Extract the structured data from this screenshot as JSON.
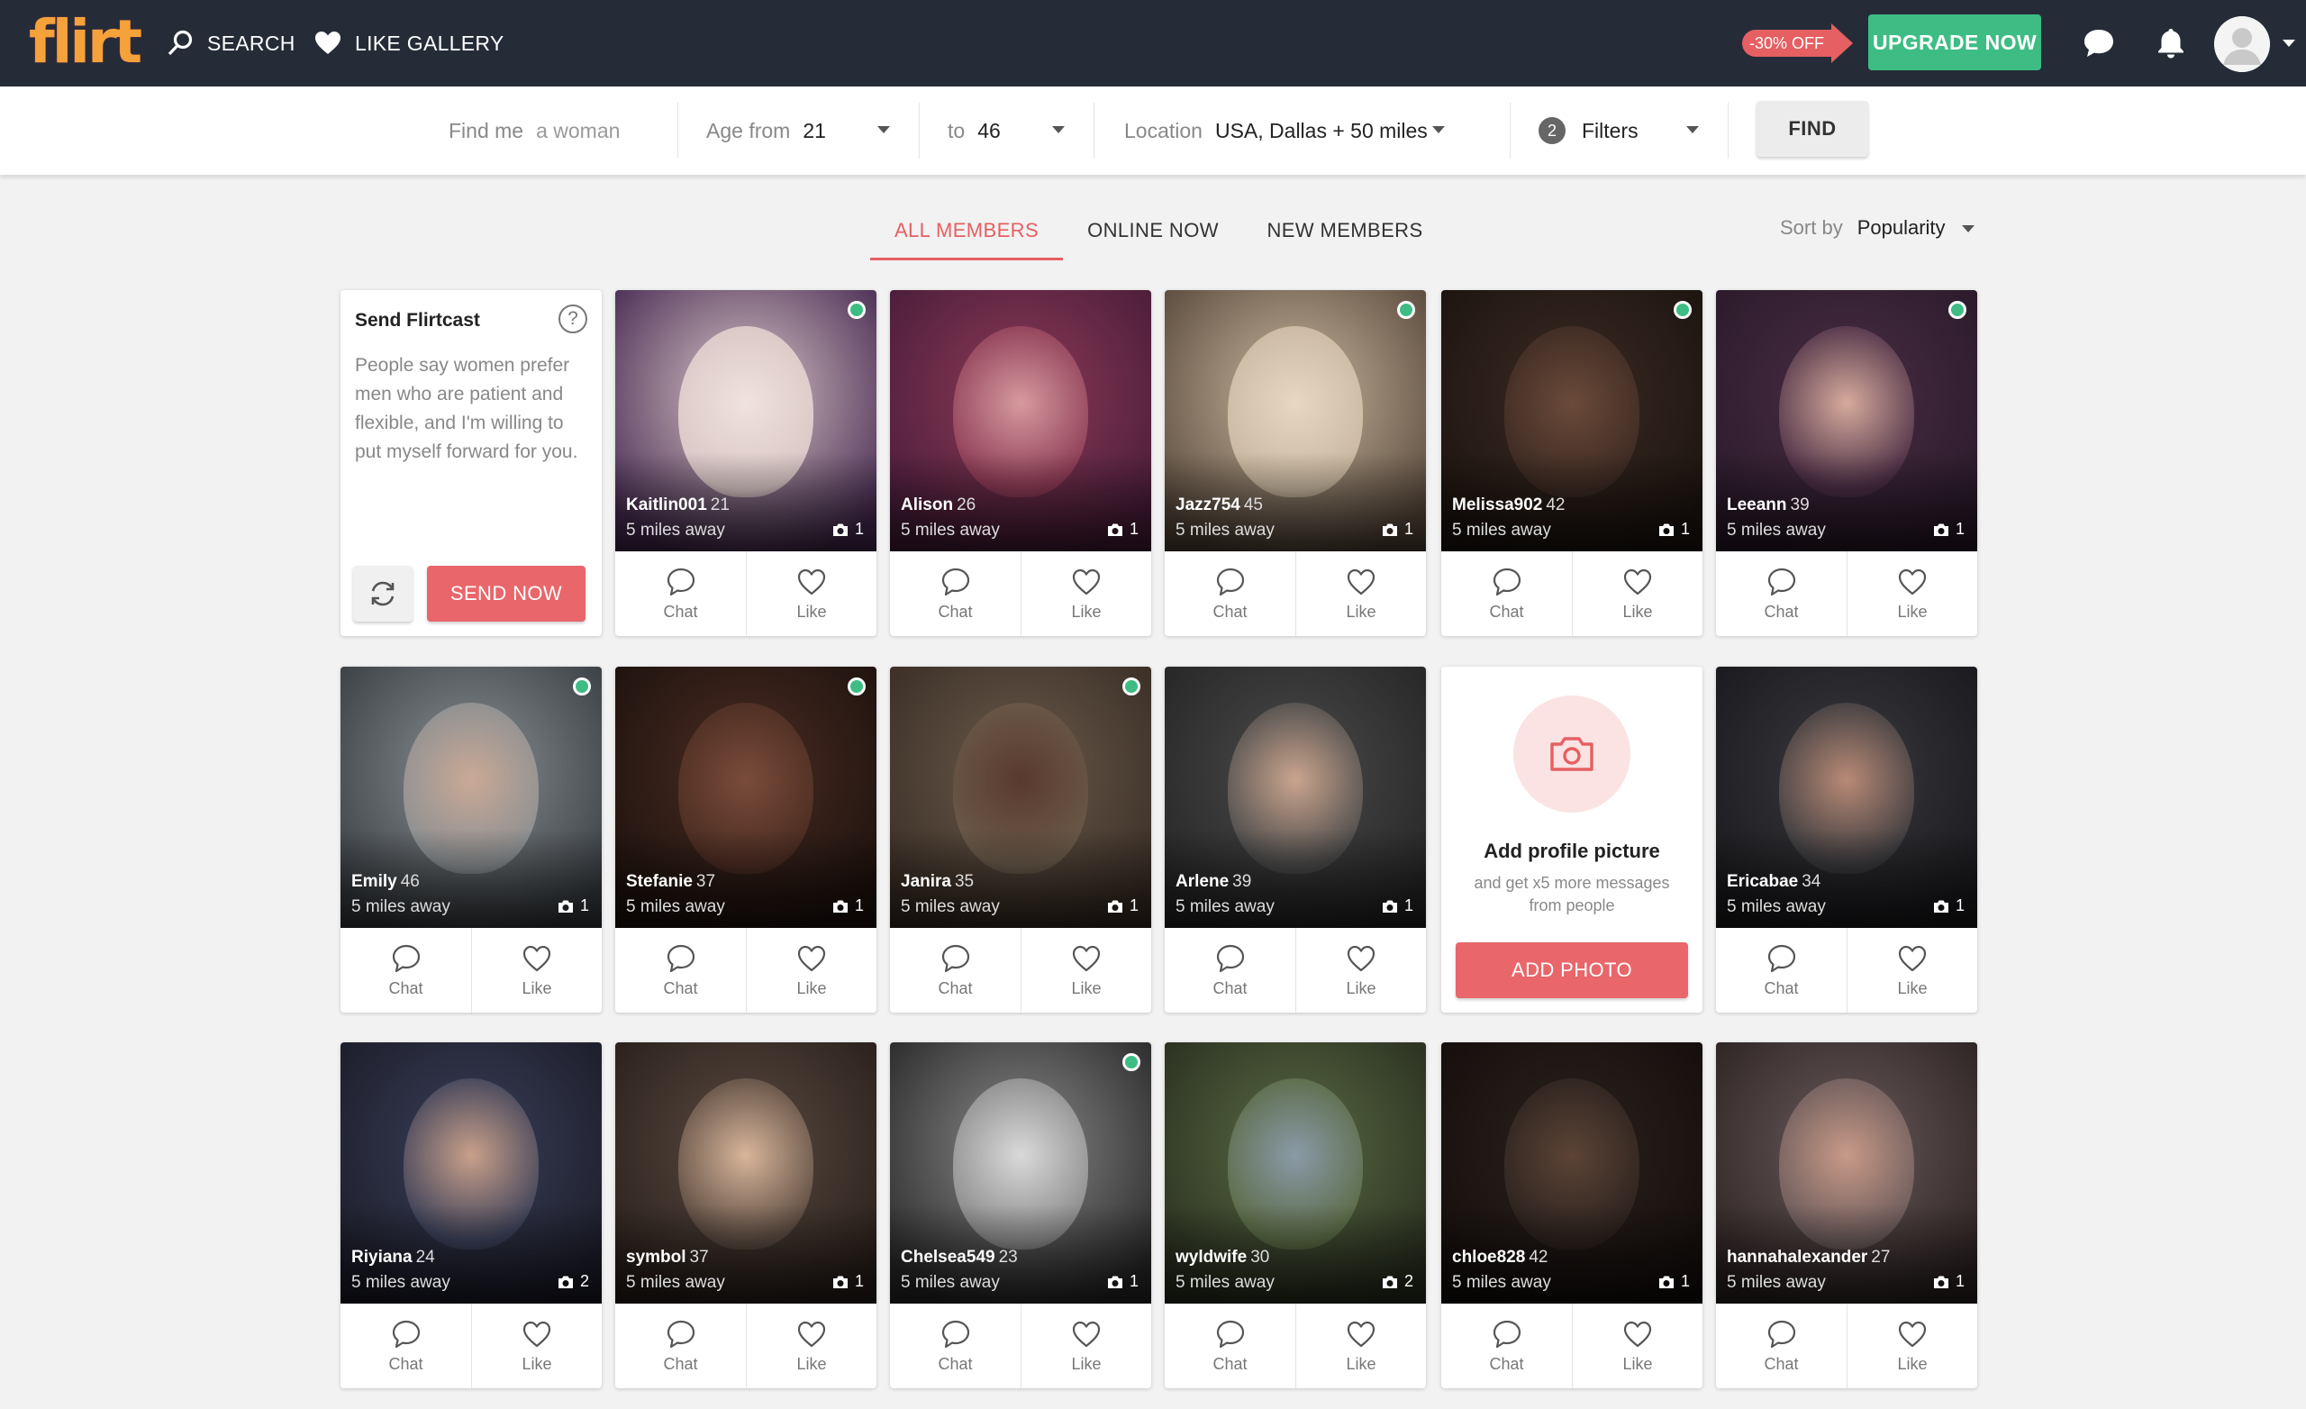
{
  "header": {
    "logo_text": "flirt",
    "search_label": "SEARCH",
    "gallery_label": "LIKE GALLERY",
    "discount_label": "-30% OFF",
    "upgrade_label": "UPGRADE NOW"
  },
  "filters": {
    "find_me_label": "Find me",
    "find_me_value": "a woman",
    "age_from_label": "Age from",
    "age_from_value": "21",
    "age_to_label": "to",
    "age_to_value": "46",
    "location_label": "Location",
    "location_value": "USA, Dallas + 50 miles",
    "filter_count": "2",
    "filters_label": "Filters",
    "find_button": "FIND"
  },
  "tabs": [
    {
      "label": "ALL MEMBERS",
      "active": true
    },
    {
      "label": "ONLINE NOW",
      "active": false
    },
    {
      "label": "NEW MEMBERS",
      "active": false
    }
  ],
  "sort": {
    "label": "Sort by",
    "value": "Popularity"
  },
  "actions": {
    "chat": "Chat",
    "like": "Like"
  },
  "flirtcast": {
    "title": "Send Flirtcast",
    "help": "?",
    "text": "People say women prefer men who are patient and flexible, and I'm willing to put myself forward for you.",
    "send_button": "SEND NOW"
  },
  "add_photo": {
    "title": "Add profile picture",
    "subtitle": "and get x5 more messages from people",
    "button": "ADD PHOTO"
  },
  "profiles": [
    {
      "name": "Kaitlin001",
      "age": "21",
      "distance": "5 miles away",
      "photos": "1",
      "online": true
    },
    {
      "name": "Alison",
      "age": "26",
      "distance": "5 miles away",
      "photos": "1",
      "online": false
    },
    {
      "name": "Jazz754",
      "age": "45",
      "distance": "5 miles away",
      "photos": "1",
      "online": true
    },
    {
      "name": "Melissa902",
      "age": "42",
      "distance": "5 miles away",
      "photos": "1",
      "online": true
    },
    {
      "name": "Leeann",
      "age": "39",
      "distance": "5 miles away",
      "photos": "1",
      "online": true
    },
    {
      "name": "Emily",
      "age": "46",
      "distance": "5 miles away",
      "photos": "1",
      "online": true
    },
    {
      "name": "Stefanie",
      "age": "37",
      "distance": "5 miles away",
      "photos": "1",
      "online": true
    },
    {
      "name": "Janira",
      "age": "35",
      "distance": "5 miles away",
      "photos": "1",
      "online": true
    },
    {
      "name": "Arlene",
      "age": "39",
      "distance": "5 miles away",
      "photos": "1",
      "online": false
    },
    {
      "name": "Ericabae",
      "age": "34",
      "distance": "5 miles away",
      "photos": "1",
      "online": false
    },
    {
      "name": "Riyiana",
      "age": "24",
      "distance": "5 miles away",
      "photos": "2",
      "online": false
    },
    {
      "name": "symbol",
      "age": "37",
      "distance": "5 miles away",
      "photos": "1",
      "online": false
    },
    {
      "name": "Chelsea549",
      "age": "23",
      "distance": "5 miles away",
      "photos": "1",
      "online": true
    },
    {
      "name": "wyldwife",
      "age": "30",
      "distance": "5 miles away",
      "photos": "2",
      "online": false
    },
    {
      "name": "chloe828",
      "age": "42",
      "distance": "5 miles away",
      "photos": "1",
      "online": false
    },
    {
      "name": "hannahalexander",
      "age": "27",
      "distance": "5 miles away",
      "photos": "1",
      "online": false
    }
  ],
  "colors": {
    "header_bg": "#252c38",
    "accent": "#e65f62",
    "upgrade": "#3dbd83",
    "online": "#3dbd83"
  }
}
